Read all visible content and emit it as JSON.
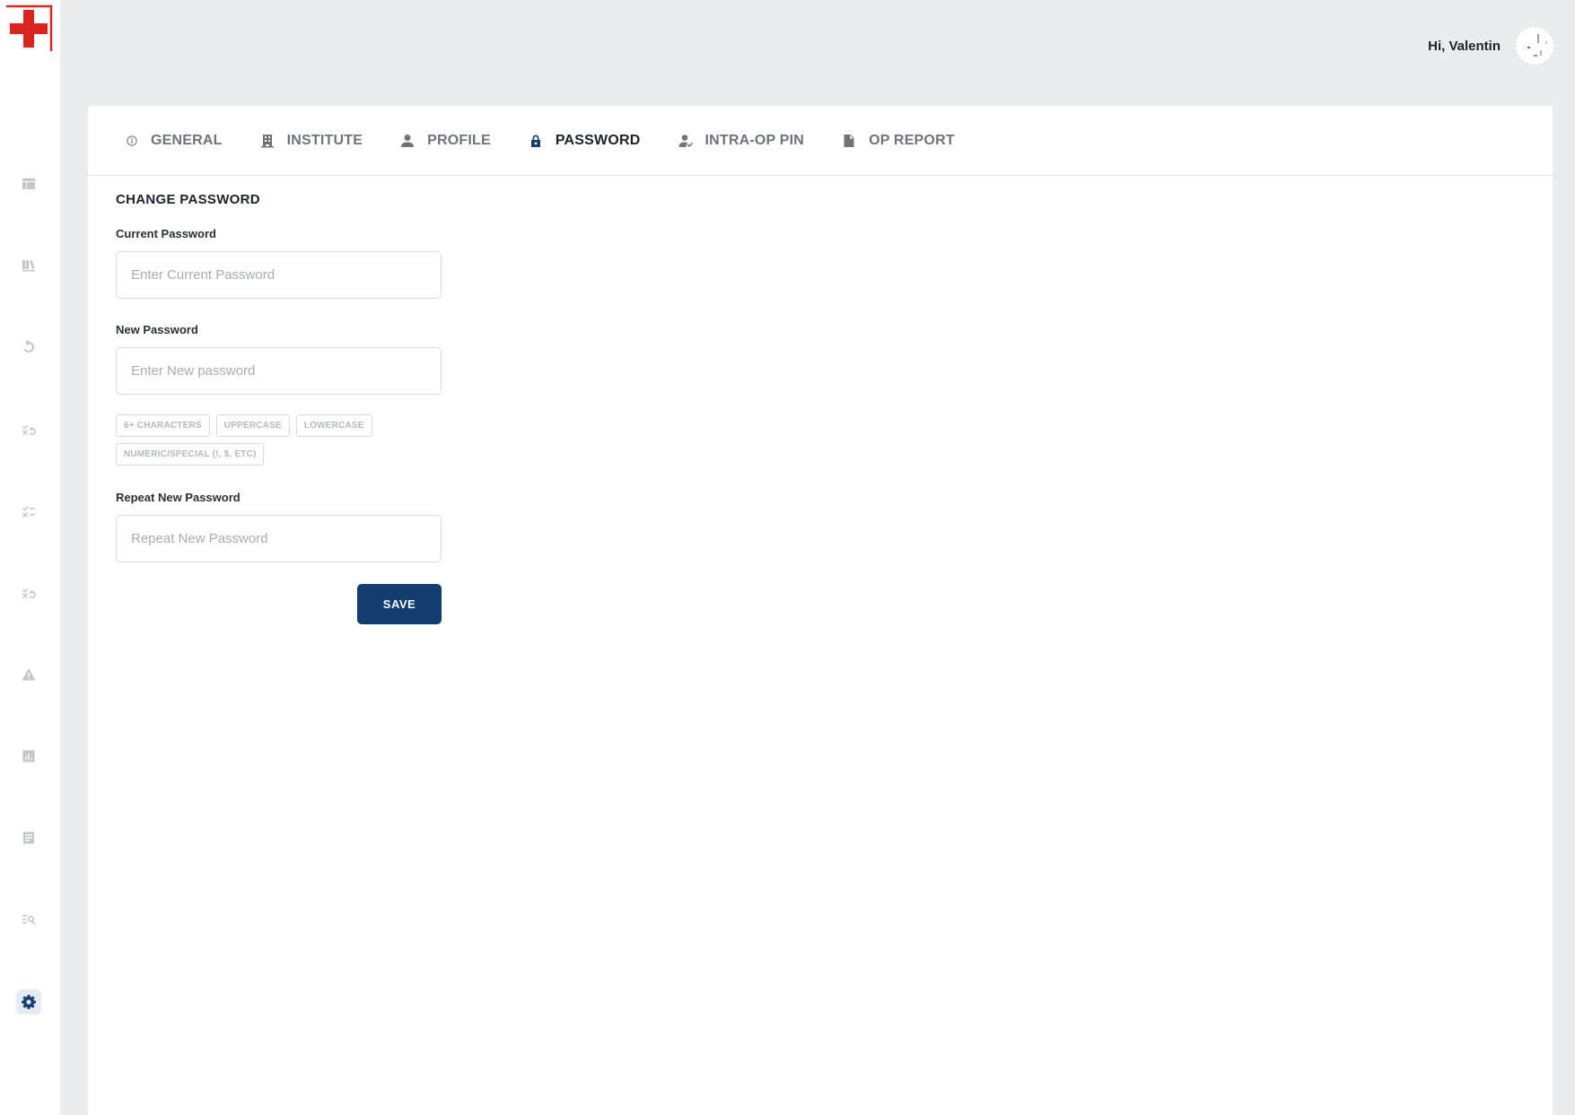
{
  "header": {
    "greeting": "Hi, Valentin"
  },
  "brand": {
    "logo_icon": "red-cross-icon",
    "accent_color": "#123d6e",
    "logo_color": "#d9251d"
  },
  "sidebar": {
    "items": [
      {
        "icon": "dashboard-icon",
        "active": false
      },
      {
        "icon": "library-icon",
        "active": false
      },
      {
        "icon": "undo-icon",
        "active": false
      },
      {
        "icon": "check-undo-icon",
        "active": false
      },
      {
        "icon": "checklist-icon",
        "active": false
      },
      {
        "icon": "check-undo-alt-icon",
        "active": false
      },
      {
        "icon": "warning-icon",
        "active": false
      },
      {
        "icon": "chart-icon",
        "active": false
      },
      {
        "icon": "report-icon",
        "active": false
      },
      {
        "icon": "search-list-icon",
        "active": false
      },
      {
        "icon": "gear-icon",
        "active": true
      }
    ]
  },
  "tabs": [
    {
      "label": "GENERAL",
      "icon": "info-icon",
      "active": false
    },
    {
      "label": "INSTITUTE",
      "icon": "building-icon",
      "active": false
    },
    {
      "label": "PROFILE",
      "icon": "person-icon",
      "active": false
    },
    {
      "label": "PASSWORD",
      "icon": "lock-icon",
      "active": true
    },
    {
      "label": "INTRA-OP PIN",
      "icon": "user-check-icon",
      "active": false
    },
    {
      "label": "OP REPORT",
      "icon": "document-icon",
      "active": false
    }
  ],
  "form": {
    "title": "CHANGE PASSWORD",
    "current_label": "Current Password",
    "current_placeholder": "Enter Current Password",
    "current_value": "",
    "new_label": "New Password",
    "new_placeholder": "Enter New password",
    "new_value": "",
    "rules": [
      "6+ CHARACTERS",
      "UPPERCASE",
      "LOWERCASE",
      "NUMERIC/SPECIAL (!, $, ETC)"
    ],
    "repeat_label": "Repeat New Password",
    "repeat_placeholder": "Repeat New Password",
    "repeat_value": "",
    "save_label": "SAVE"
  }
}
